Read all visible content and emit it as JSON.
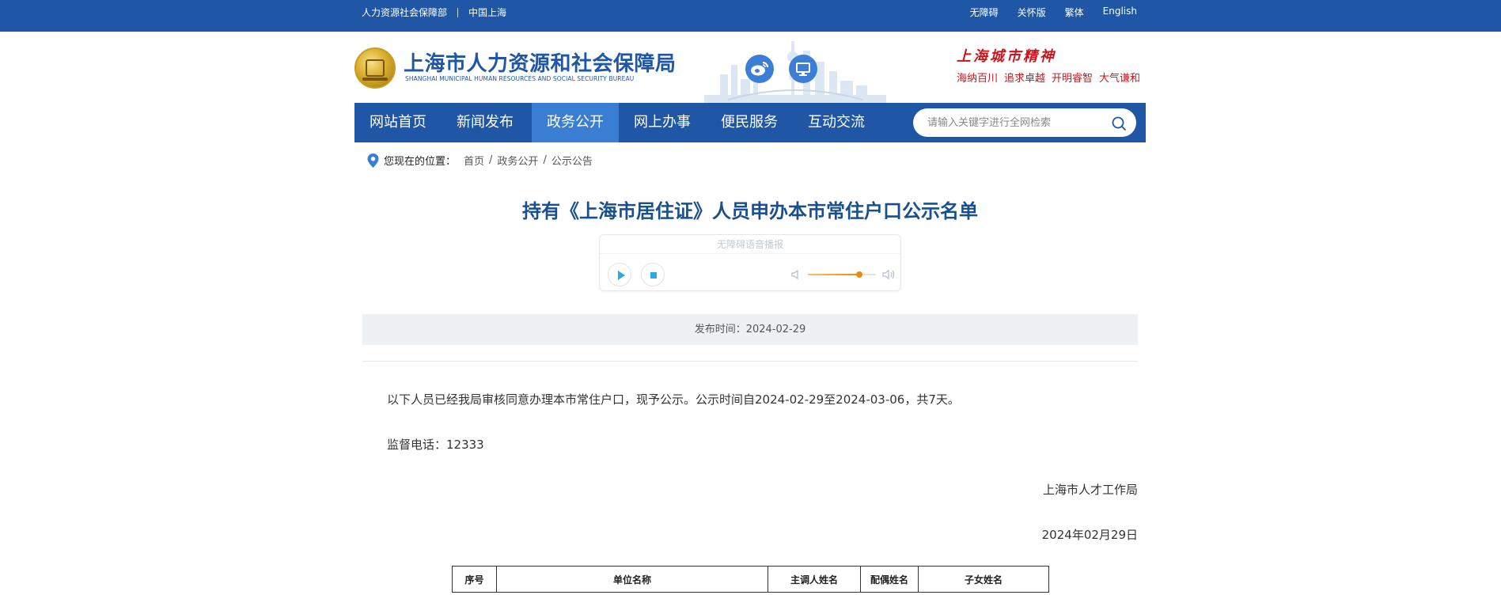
{
  "topbar": {
    "left_links": [
      "人力资源社会保障部",
      "中国上海"
    ],
    "right_links": [
      "无障碍",
      "关怀版",
      "繁体",
      "English"
    ]
  },
  "header": {
    "site_name": "上海市人力资源和社会保障局",
    "site_name_en": "SHANGHAI MUNICIPAL HUMAN RESOURCES AND SOCIAL SECURITY BUREAU",
    "social_icons": [
      "weibo-icon",
      "monitor-icon"
    ],
    "spirit_title": "上海城市精神",
    "spirit_words": [
      "海纳百川",
      "追求卓越",
      "开明睿智",
      "大气谦和"
    ]
  },
  "nav": {
    "items": [
      "网站首页",
      "新闻发布",
      "政务公开",
      "网上办事",
      "便民服务",
      "互动交流"
    ],
    "active_index": 2,
    "search_placeholder": "请输入关键字进行全网检索"
  },
  "breadcrumb": {
    "label": "您现在的位置：",
    "items": [
      "首页",
      "政务公开",
      "公示公告"
    ]
  },
  "article": {
    "title": "持有《上海市居住证》人员申办本市常住户口公示名单",
    "player": {
      "title": "无障碍语音播报",
      "volume": 0.75
    },
    "publish": "发布时间：2024-02-29",
    "paragraph1": "以下人员已经我局审核同意办理本市常住户口，现予公示。公示时间自2024-02-29至2024-03-06，共7天。",
    "paragraph2": "监督电话：12333",
    "signature": "上海市人才工作局",
    "sign_date": "2024年02月29日",
    "table_headers": [
      "序号",
      "单位名称",
      "主调人姓名",
      "配偶姓名",
      "子女姓名"
    ]
  },
  "colors": {
    "brand_blue": "#1f56a6",
    "nav_active": "#3a7ed4",
    "title_blue": "#1a4f8e",
    "spirit_red": "#c8161d",
    "volume_orange": "#f08a00"
  }
}
